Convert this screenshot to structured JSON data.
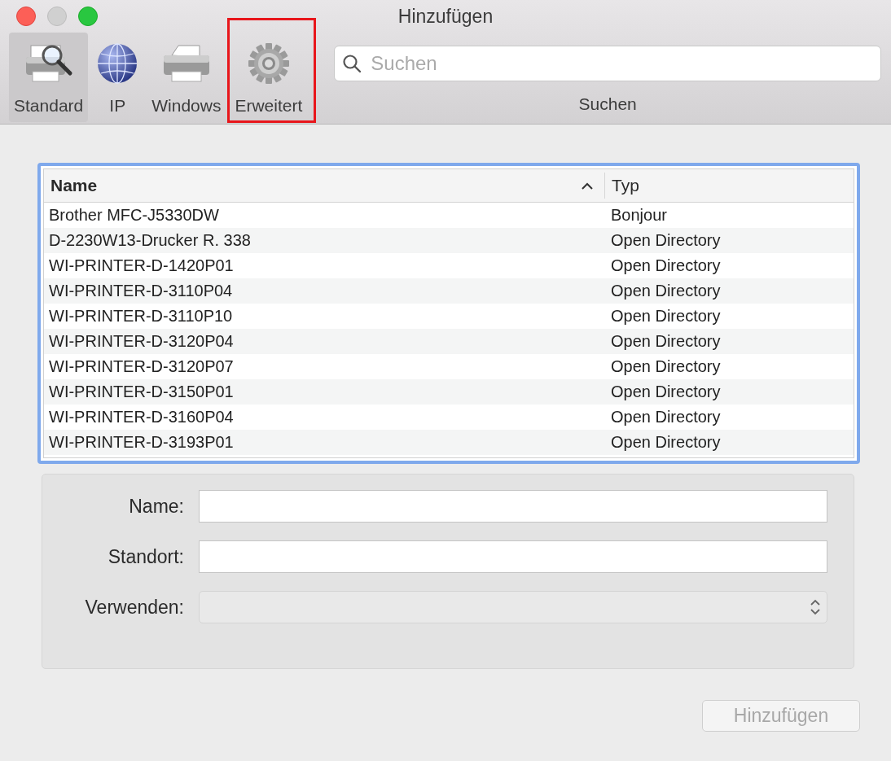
{
  "window": {
    "title": "Hinzufügen"
  },
  "toolbar": {
    "items": [
      {
        "label": "Standard",
        "kind": "standard",
        "selected": true,
        "highlighted": false
      },
      {
        "label": "IP",
        "kind": "ip",
        "selected": false,
        "highlighted": false
      },
      {
        "label": "Windows",
        "kind": "windows",
        "selected": false,
        "highlighted": false
      },
      {
        "label": "Erweitert",
        "kind": "advanced",
        "selected": false,
        "highlighted": true
      }
    ],
    "search": {
      "placeholder": "Suchen",
      "label": "Suchen"
    }
  },
  "table": {
    "columns": [
      {
        "label": "Name",
        "sorted_ascending": true
      },
      {
        "label": "Typ"
      }
    ],
    "rows": [
      {
        "name": "Brother MFC-J5330DW",
        "type": "Bonjour"
      },
      {
        "name": "D-2230W13-Drucker R. 338",
        "type": "Open Directory"
      },
      {
        "name": "WI-PRINTER-D-1420P01",
        "type": "Open Directory"
      },
      {
        "name": "WI-PRINTER-D-3110P04",
        "type": "Open Directory"
      },
      {
        "name": "WI-PRINTER-D-3110P10",
        "type": "Open Directory"
      },
      {
        "name": "WI-PRINTER-D-3120P04",
        "type": "Open Directory"
      },
      {
        "name": "WI-PRINTER-D-3120P07",
        "type": "Open Directory"
      },
      {
        "name": "WI-PRINTER-D-3150P01",
        "type": "Open Directory"
      },
      {
        "name": "WI-PRINTER-D-3160P04",
        "type": "Open Directory"
      },
      {
        "name": "WI-PRINTER-D-3193P01",
        "type": "Open Directory"
      }
    ]
  },
  "form": {
    "fields": [
      {
        "label": "Name:",
        "kind": "text",
        "disabled": false
      },
      {
        "label": "Standort:",
        "kind": "text",
        "disabled": false
      },
      {
        "label": "Verwenden:",
        "kind": "popup",
        "disabled": true
      }
    ]
  },
  "buttons": [
    {
      "label": "Hinzufügen",
      "disabled": true
    }
  ]
}
